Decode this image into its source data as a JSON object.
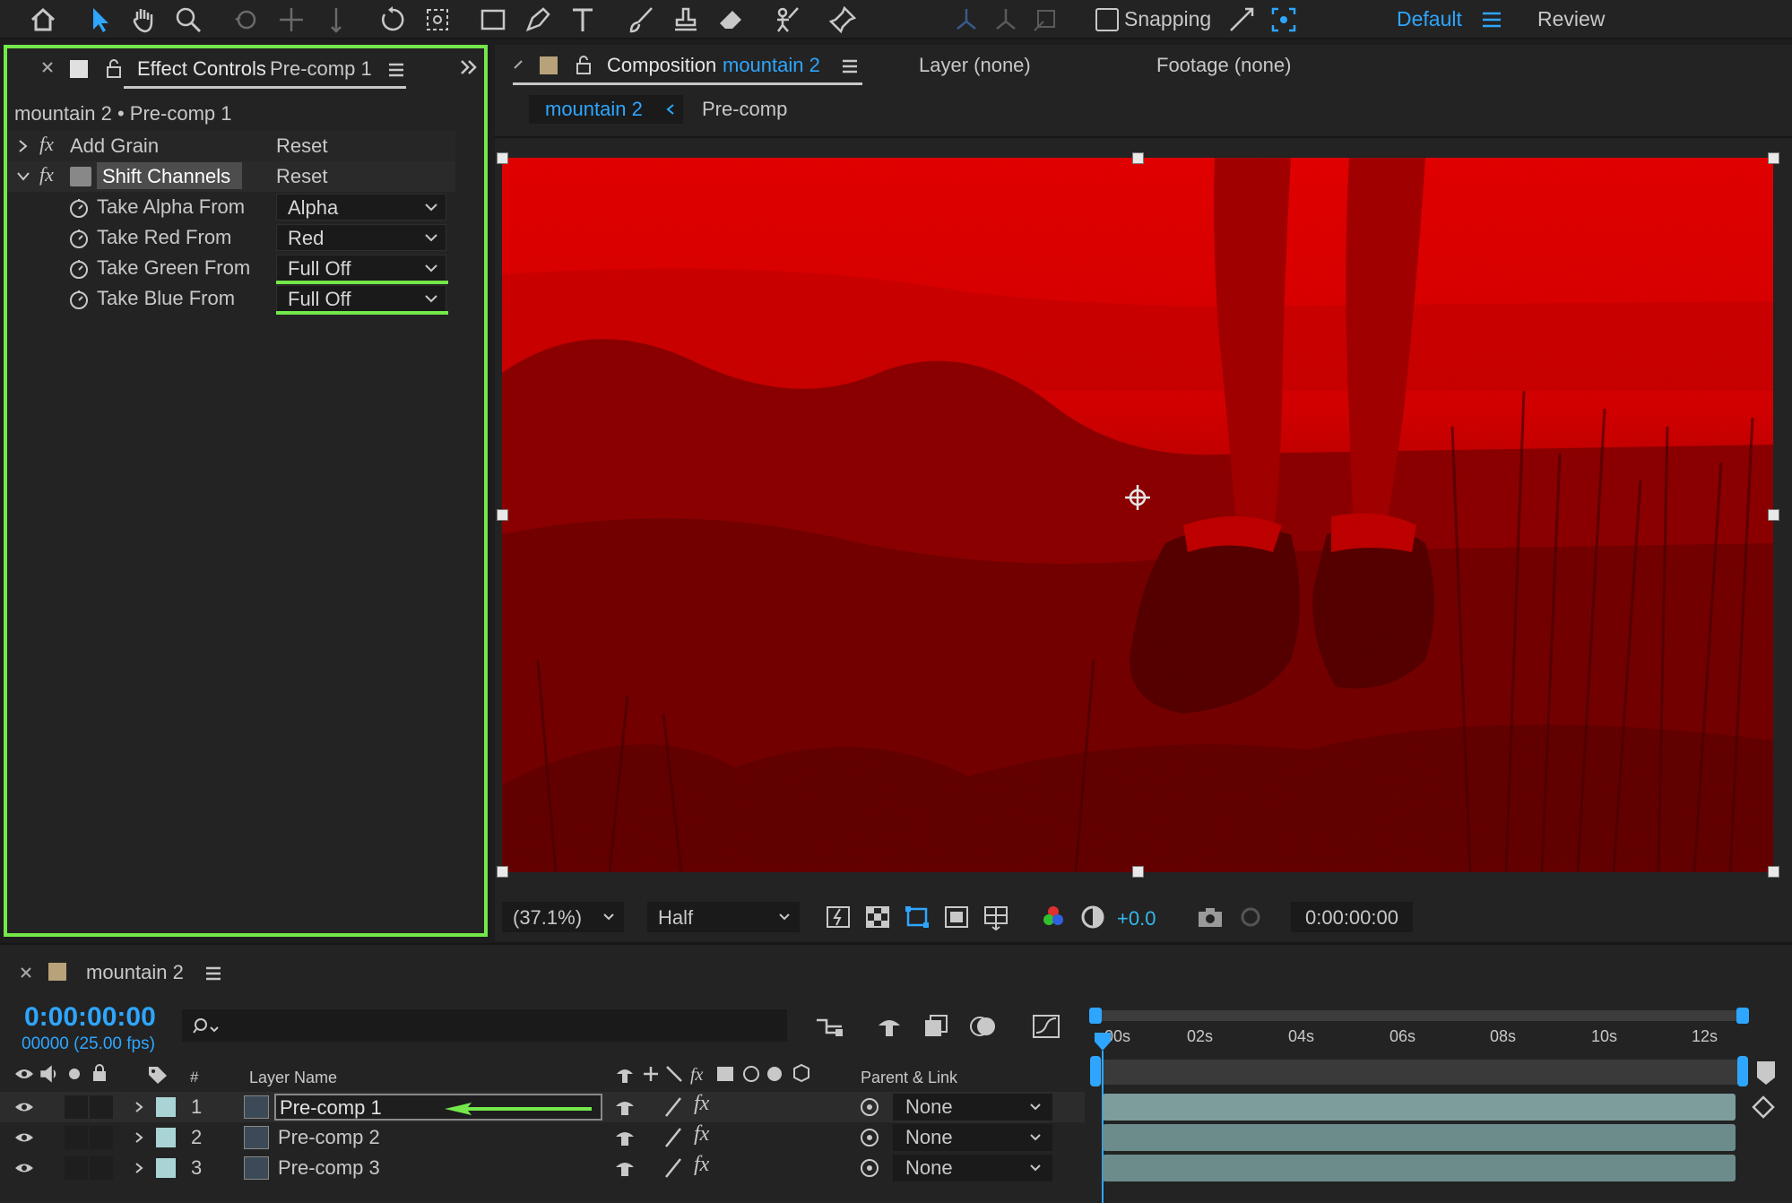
{
  "toolbar": {
    "snapping_label": "Snapping",
    "workspace_active": "Default",
    "workspace_other": "Review",
    "tools": [
      "home-icon",
      "selection-arrow-icon",
      "hand-icon",
      "zoom-icon",
      "orbit-camera-icon",
      "pan-camera-icon",
      "dolly-camera-icon",
      "rotate-icon",
      "anchor-point-icon",
      "rectangle-icon",
      "pen-icon",
      "type-icon",
      "brush-icon",
      "clone-stamp-icon",
      "eraser-icon",
      "roto-brush-icon",
      "puppet-pin-icon"
    ]
  },
  "effect_controls": {
    "tab_prefix": "Effect Controls",
    "tab_target": "Pre-comp 1",
    "breadcrumb": "mountain 2 • Pre-comp 1",
    "effects": [
      {
        "name": "Add Grain",
        "reset": "Reset",
        "expanded": false
      },
      {
        "name": "Shift Channels",
        "reset": "Reset",
        "expanded": true
      }
    ],
    "properties": [
      {
        "label": "Take Alpha From",
        "value": "Alpha"
      },
      {
        "label": "Take Red From",
        "value": "Red"
      },
      {
        "label": "Take Green From",
        "value": "Full Off"
      },
      {
        "label": "Take Blue From",
        "value": "Full Off"
      }
    ]
  },
  "composition": {
    "tab_prefix": "Composition",
    "tab_name": "mountain 2",
    "layer_tab": "Layer (none)",
    "footage_tab": "Footage (none)",
    "crumb_active": "mountain 2",
    "crumb_next": "Pre-comp",
    "zoom": "(37.1%)",
    "resolution": "Half",
    "exposure": "+0.0",
    "timecode": "0:00:00:00"
  },
  "timeline": {
    "comp_name": "mountain 2",
    "current_time": "0:00:00:00",
    "frame_info": "00000 (25.00 fps)",
    "search_placeholder": "",
    "col_number": "#",
    "col_layer_name": "Layer Name",
    "col_parent": "Parent & Link",
    "ruler_ticks": [
      "00s",
      "02s",
      "04s",
      "06s",
      "08s",
      "10s",
      "12s"
    ],
    "layers": [
      {
        "num": "1",
        "name": "Pre-comp 1",
        "parent": "None"
      },
      {
        "num": "2",
        "name": "Pre-comp 2",
        "parent": "None"
      },
      {
        "num": "3",
        "name": "Pre-comp 3",
        "parent": "None"
      }
    ]
  },
  "colors": {
    "accent_blue": "#2ea6ff",
    "highlight_green": "#74e84a",
    "comp_red": "#d40000"
  }
}
